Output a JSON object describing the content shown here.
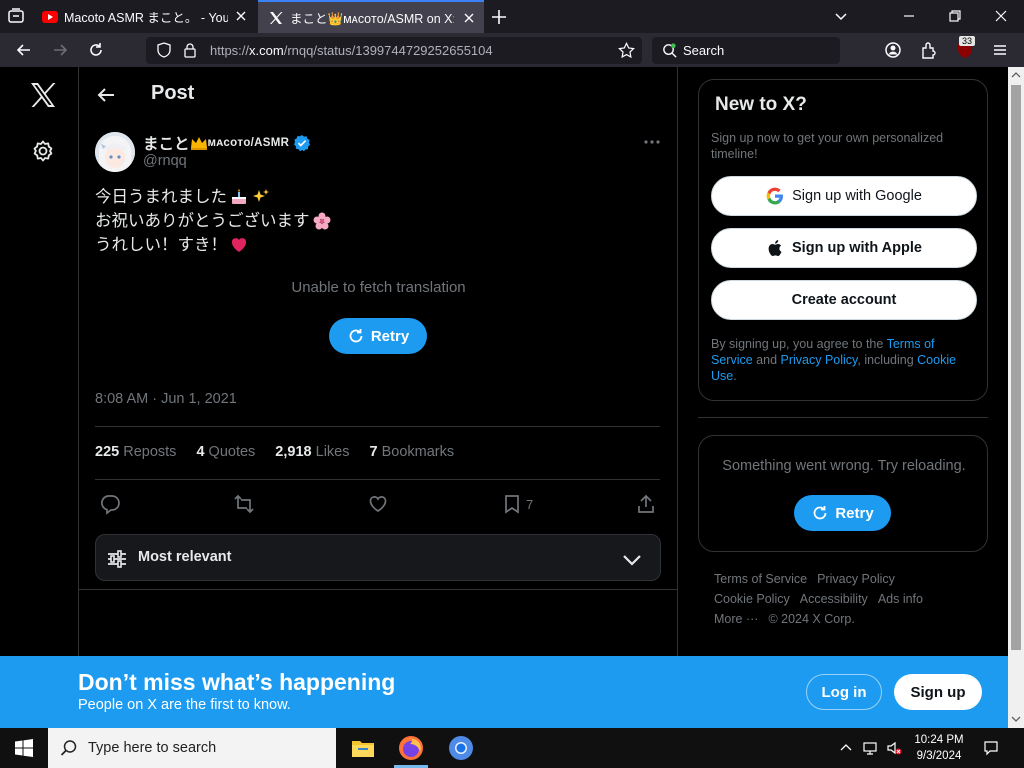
{
  "browser": {
    "tabs": [
      {
        "title": "Macoto ASMR まこと。 - YouTube",
        "active": false
      },
      {
        "title": "まこと👑ᴍᴀᴄᴏᴛᴏ/ASMR on X: \"",
        "active": true
      }
    ],
    "url_prefix": "https://",
    "url_host": "x.com",
    "url_path": "/rnqq/status/1399744729252655104",
    "search_placeholder": "Search",
    "extension_badge": "33"
  },
  "header": {
    "title": "Post"
  },
  "post": {
    "display_name": "まこと",
    "display_name_tail": "ᴍᴀᴄᴏᴛᴏ/ASMR",
    "handle": "@rnqq",
    "lines": [
      "今日うまれました",
      "お祝いありがとうございます",
      "うれしい！すき！"
    ],
    "translation_error": "Unable to fetch translation",
    "retry_label": "Retry",
    "timestamp": "8:08 AM · Jun 1, 2021",
    "stats": [
      {
        "count": "225",
        "label": "Reposts"
      },
      {
        "count": "4",
        "label": "Quotes"
      },
      {
        "count": "2,918",
        "label": "Likes"
      },
      {
        "count": "7",
        "label": "Bookmarks"
      }
    ],
    "bookmark_count": "7",
    "sort_label": "Most relevant"
  },
  "sidebar": {
    "title": "New to X?",
    "subtitle": "Sign up now to get your own personalized timeline!",
    "google_label": "Sign up with Google",
    "apple_label": "Sign up with Apple",
    "create_label": "Create account",
    "terms_pre": "By signing up, you agree to the ",
    "terms_link": "Terms of Service",
    "terms_mid": " and ",
    "privacy_link": "Privacy Policy",
    "terms_mid2": ", including ",
    "cookie_link": "Cookie Use",
    "terms_end": ".",
    "error_message": "Something went wrong. Try reloading.",
    "retry_label": "Retry",
    "footer": [
      "Terms of Service",
      "Privacy Policy",
      "Cookie Policy",
      "Accessibility",
      "Ads info",
      "More ···",
      "© 2024 X Corp."
    ]
  },
  "banner": {
    "headline": "Don’t miss what’s happening",
    "subline": "People on X are the first to know.",
    "login_label": "Log in",
    "signup_label": "Sign up"
  },
  "taskbar": {
    "search_placeholder": "Type here to search",
    "time": "10:24 PM",
    "date": "9/3/2024"
  },
  "colors": {
    "accent": "#1d9bf0",
    "background": "#000000",
    "muted": "#71767b"
  }
}
